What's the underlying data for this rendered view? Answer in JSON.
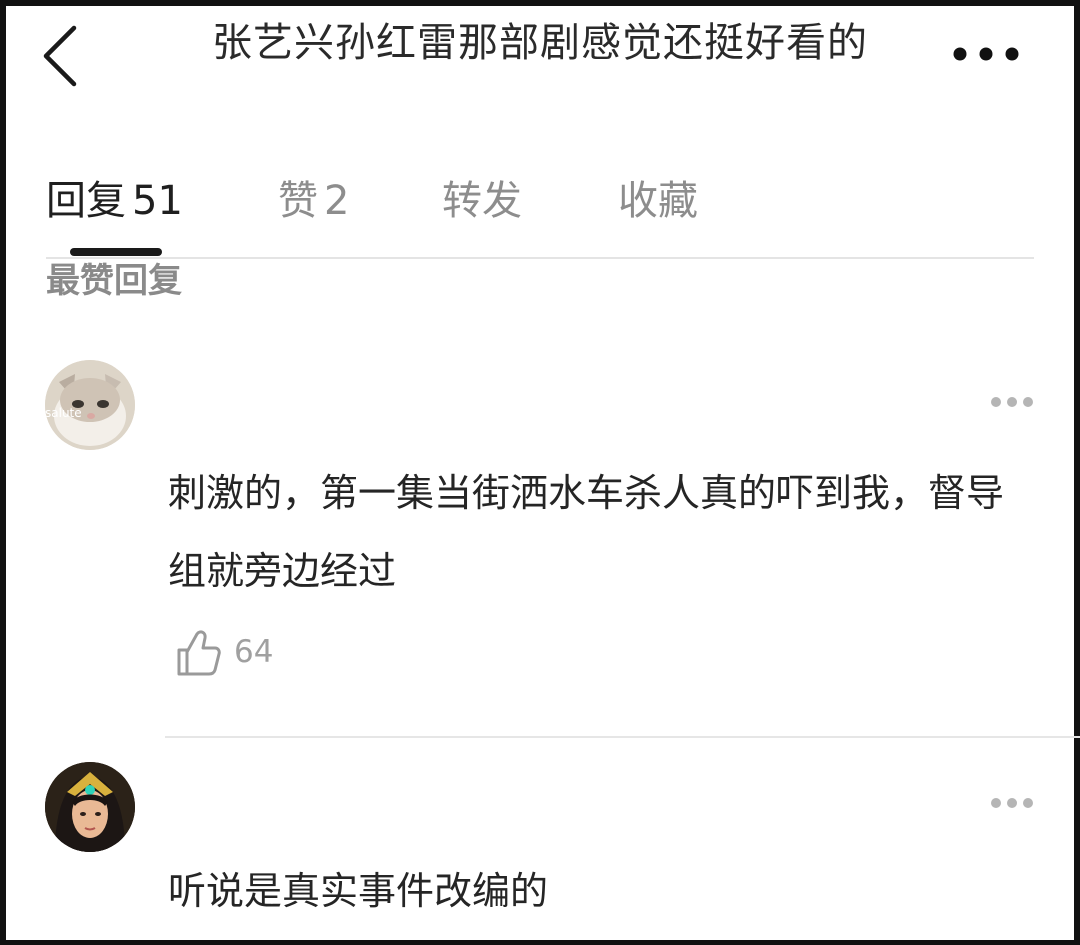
{
  "header": {
    "title": "张艺兴孙红雷那部剧感觉还挺好看的"
  },
  "tabs": [
    {
      "label": "回复",
      "count": "51",
      "active": true
    },
    {
      "label": "赞",
      "count": "2",
      "active": false
    },
    {
      "label": "转发",
      "count": "",
      "active": false
    },
    {
      "label": "收藏",
      "count": "",
      "active": false
    }
  ],
  "section": {
    "title": "最赞回复"
  },
  "comments": [
    {
      "avatar_text": "salute",
      "avatar_icon": "cat-avatar",
      "text": "刺激的，第一集当街洒水车杀人真的吓到我，督导组就旁边经过",
      "likes": "64"
    },
    {
      "avatar_icon": "game-hero-avatar",
      "text": "听说是真实事件改编的"
    }
  ],
  "colors": {
    "active_tab": "#1f1f1f",
    "inactive_tab": "#8d8d8d",
    "meta_gray": "#a0a0a0",
    "divider": "#e4e4e4"
  }
}
